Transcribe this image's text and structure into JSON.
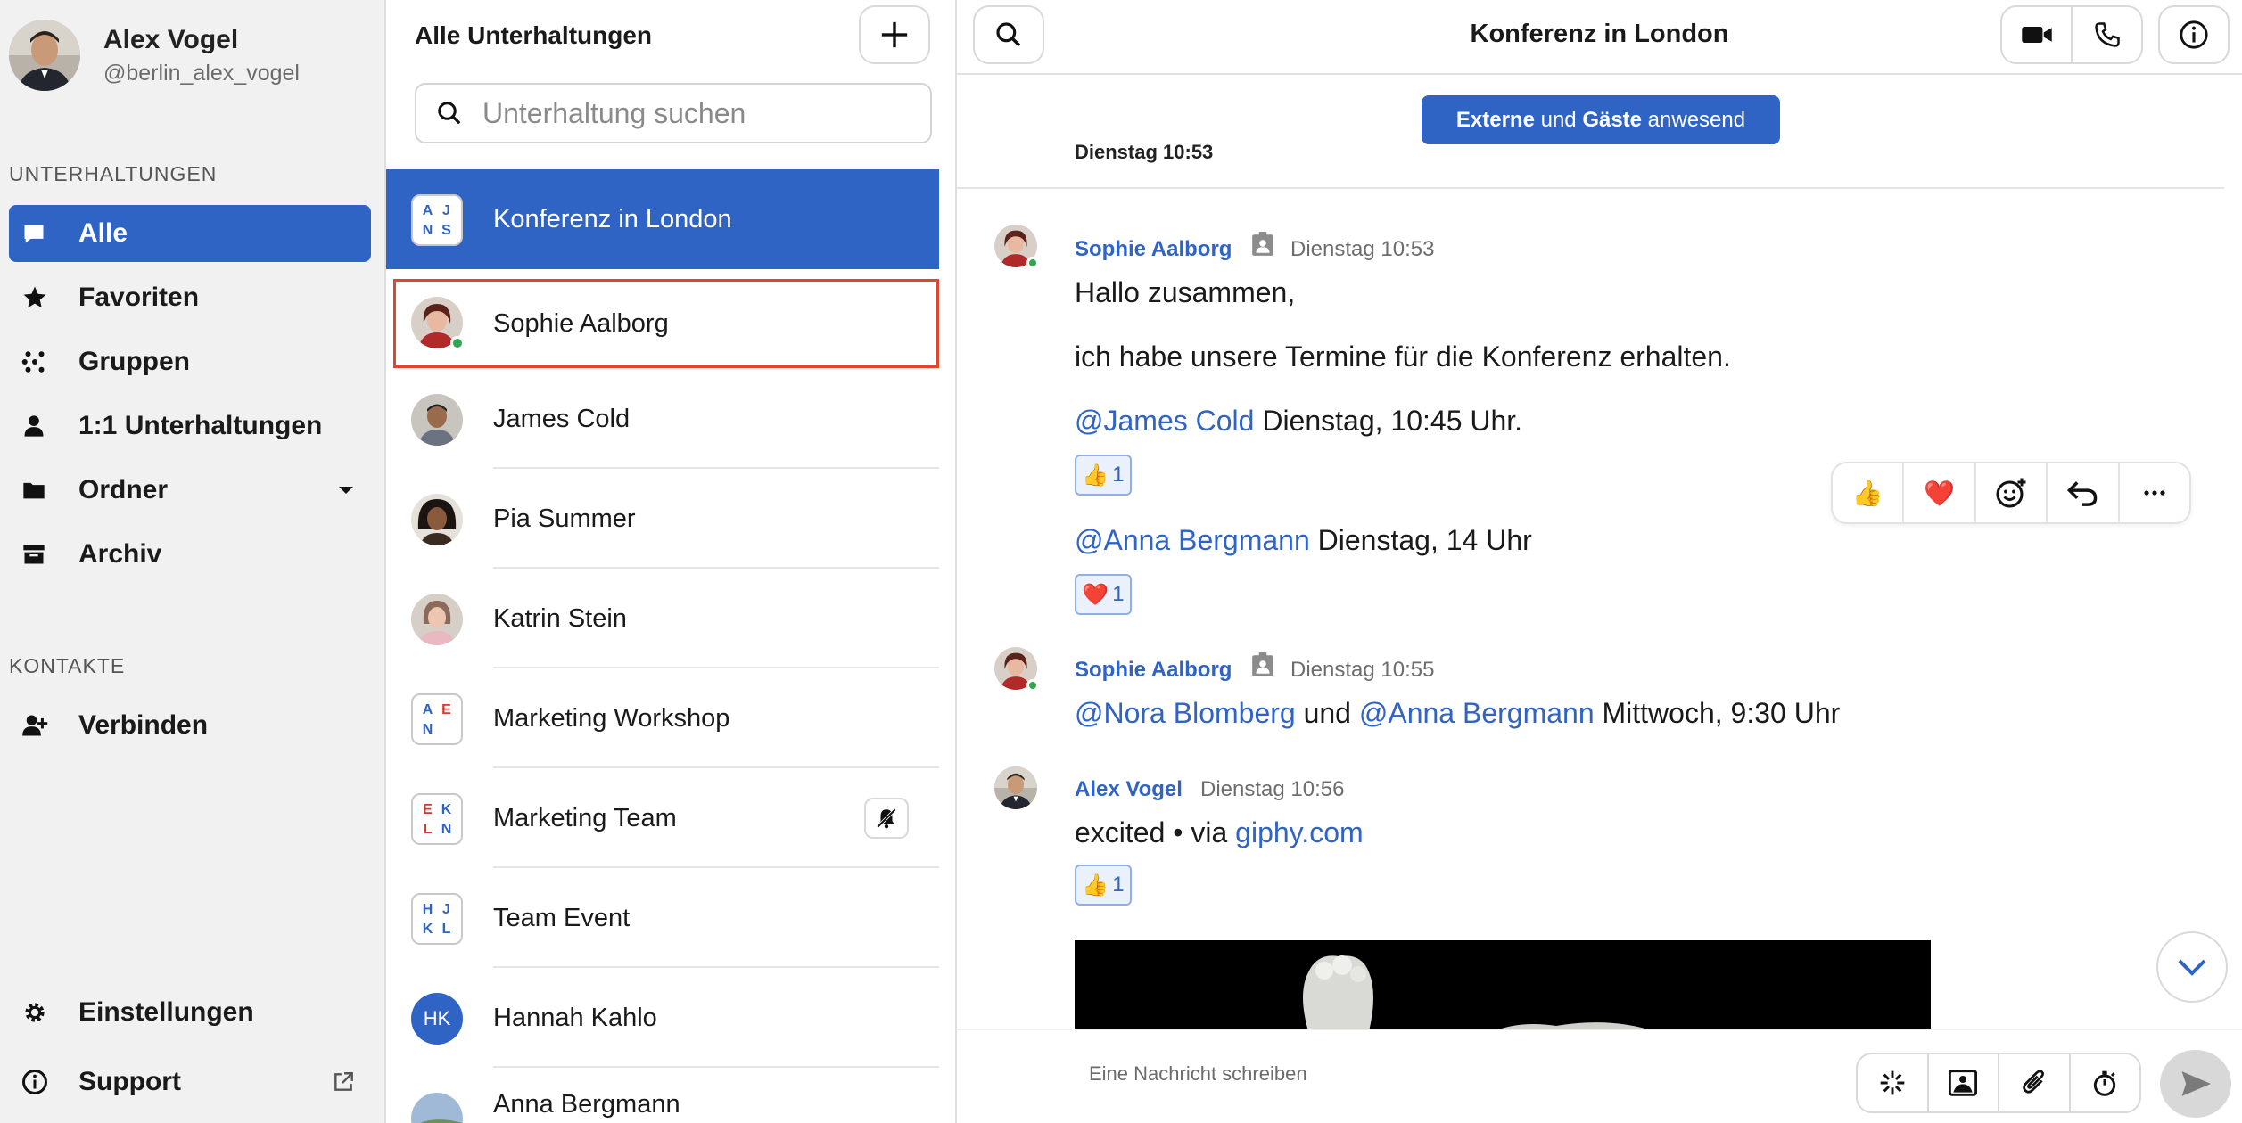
{
  "profile": {
    "name": "Alex Vogel",
    "handle": "@berlin_alex_vogel"
  },
  "sidebar": {
    "section_conversations": "UNTERHALTUNGEN",
    "items": [
      {
        "label": "Alle",
        "icon": "chat-bubble-icon",
        "active": true
      },
      {
        "label": "Favoriten",
        "icon": "star-icon"
      },
      {
        "label": "Gruppen",
        "icon": "group-dots-icon"
      },
      {
        "label": "1:1 Unterhaltungen",
        "icon": "person-icon"
      },
      {
        "label": "Ordner",
        "icon": "folder-icon"
      },
      {
        "label": "Archiv",
        "icon": "archive-box-icon"
      }
    ],
    "section_contacts": "KONTAKTE",
    "connect": "Verbinden",
    "settings": "Einstellungen",
    "support": "Support"
  },
  "list": {
    "title": "Alle Unterhaltungen",
    "search_placeholder": "Unterhaltung suchen",
    "conversations": [
      {
        "name": "Konferenz in London",
        "initials": [
          "A",
          "J",
          "N",
          "S"
        ],
        "active": true
      },
      {
        "name": "Sophie Aalborg",
        "online": true,
        "highlighted": true
      },
      {
        "name": "James Cold"
      },
      {
        "name": "Pia Summer"
      },
      {
        "name": "Katrin Stein"
      },
      {
        "name": "Marketing Workshop",
        "initials": [
          "A",
          "E",
          "N",
          ""
        ]
      },
      {
        "name": "Marketing Team",
        "initials": [
          "E",
          "K",
          "L",
          "N"
        ],
        "muted": true
      },
      {
        "name": "Team Event",
        "initials": [
          "H",
          "J",
          "K",
          "L"
        ]
      },
      {
        "name": "Hannah Kahlo",
        "initials_round": "HK"
      },
      {
        "name": "Anna Bergmann"
      }
    ]
  },
  "chat": {
    "title": "Konferenz in London",
    "banner": {
      "part1": "Externe",
      "part2": " und ",
      "part3": "Gäste",
      "part4": " anwesend"
    },
    "date_separator": "Dienstag 10:53",
    "messages": [
      {
        "sender": "Sophie Aalborg",
        "time": "Dienstag 10:53",
        "line1": "Hallo zusammen,",
        "line2": "ich habe unsere Termine für die Konferenz erhalten.",
        "line3_mention": "@James Cold",
        "line3_rest": " Dienstag, 10:45 Uhr.",
        "reaction1": {
          "emoji": "👍",
          "count": "1"
        },
        "line4_mention": "@Anna Bergmann",
        "line4_rest": " Dienstag, 14 Uhr",
        "reaction2": {
          "emoji": "❤️",
          "count": "1"
        }
      },
      {
        "sender": "Sophie Aalborg",
        "time": "Dienstag 10:55",
        "mention1": "@Nora Blomberg",
        "mid": " und ",
        "mention2": "@Anna Bergmann",
        "rest": " Mittwoch, 9:30 Uhr"
      },
      {
        "sender": "Alex Vogel",
        "time": "Dienstag 10:56",
        "text": "excited • via ",
        "link": "giphy.com",
        "reaction": {
          "emoji": "👍",
          "count": "1"
        }
      }
    ],
    "hover_actions": [
      "👍",
      "❤️"
    ],
    "composer_placeholder": "Eine Nachricht schreiben"
  },
  "colors": {
    "accent": "#2f63c4",
    "highlight_border": "#e0452f",
    "online": "#2fa84f"
  }
}
